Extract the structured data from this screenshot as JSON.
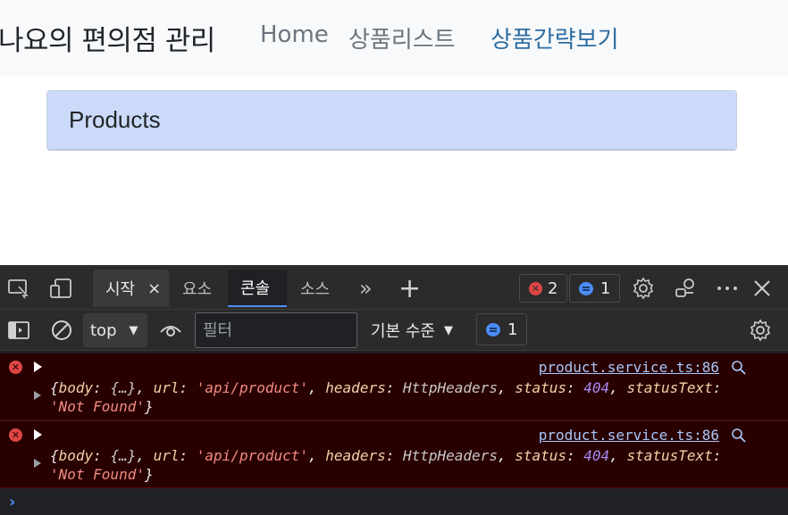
{
  "navbar": {
    "brand": "나요의 편의점 관리",
    "links": [
      {
        "label": "Home",
        "active": false
      },
      {
        "label": "상품리스트",
        "active": false
      },
      {
        "label": "상품간략보기",
        "active": true
      }
    ]
  },
  "card": {
    "header": "Products"
  },
  "devtools": {
    "tabs": {
      "start": "시작",
      "close_glyph": "×",
      "elements": "요소",
      "console": "콘솔",
      "sources": "소스",
      "more_glyph": "»",
      "add_glyph": "+"
    },
    "error_count": "2",
    "message_count": "1",
    "toolbar": {
      "context": "top",
      "filter_placeholder": "필터",
      "level": "기본 수준",
      "message_count": "1"
    },
    "logs": [
      {
        "source": "product.service.ts:86",
        "text": {
          "open": "{",
          "body_key": "body",
          "body_val": "{…}",
          "url_key": "url",
          "url_val": "'api/product'",
          "headers_key": "headers",
          "headers_val": "HttpHeaders",
          "status_key": "status",
          "status_val": "404",
          "statusText_key": "statusText",
          "statusText_val": "'Not Found'",
          "close": "}"
        }
      },
      {
        "source": "product.service.ts:86",
        "text": {
          "open": "{",
          "body_key": "body",
          "body_val": "{…}",
          "url_key": "url",
          "url_val": "'api/product'",
          "headers_key": "headers",
          "headers_val": "HttpHeaders",
          "status_key": "status",
          "status_val": "404",
          "statusText_key": "statusText",
          "statusText_val": "'Not Found'",
          "close": "}"
        }
      }
    ],
    "prompt_glyph": "›",
    "colors": {
      "error_red": "#e04646",
      "accent_blue": "#4f8df5",
      "error_bg": "#290000"
    }
  }
}
